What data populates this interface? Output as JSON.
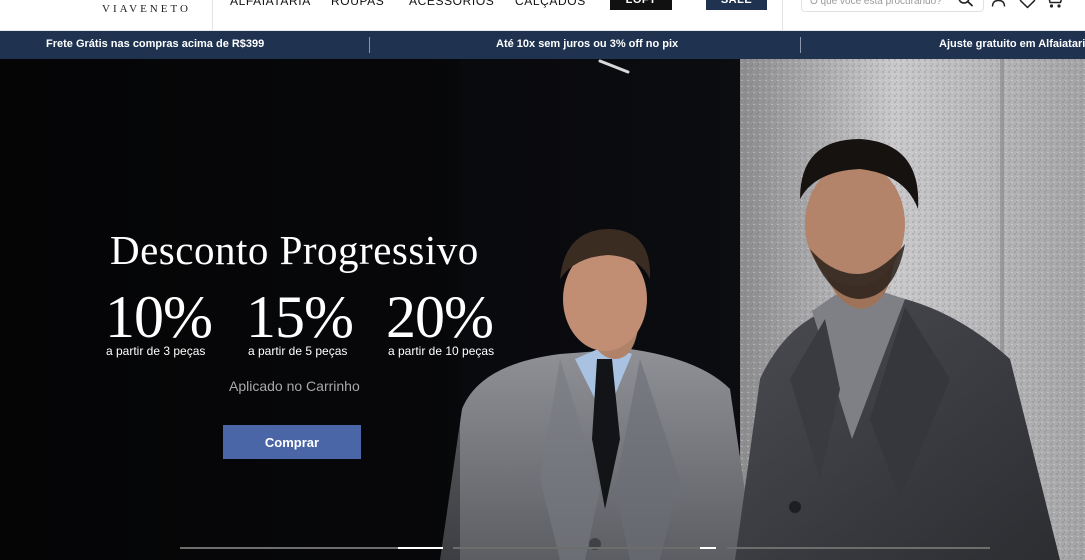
{
  "header": {
    "logo": "VIAVENETO",
    "nav": [
      "ALFAIATARIA",
      "ROUPAS",
      "ACESSÓRIOS",
      "CALÇADOS"
    ],
    "buttons": {
      "dark_label": "LOFT",
      "sale_label": "SALE"
    },
    "search": {
      "placeholder": "O que você está procurando?"
    },
    "icons": [
      "search-icon",
      "user-icon",
      "heart-icon",
      "cart-icon"
    ]
  },
  "promo_bar": {
    "items": [
      "Frete Grátis nas compras acima de R$399",
      "Até 10x sem juros ou 3% off no pix",
      "Ajuste gratuito em Alfaiataria"
    ],
    "background": "#1f3350"
  },
  "hero": {
    "title": "Desconto Progressivo",
    "discounts": [
      {
        "percent": "10%",
        "caption": "a partir de 3 peças"
      },
      {
        "percent": "15%",
        "caption": "a partir de 5 peças"
      },
      {
        "percent": "20%",
        "caption": "a partir de 10 peças"
      }
    ],
    "note": "Aplicado no Carrinho",
    "cta_label": "Comprar",
    "cta_color": "#4a66a6",
    "slides": {
      "count": 4,
      "active": 2
    }
  }
}
